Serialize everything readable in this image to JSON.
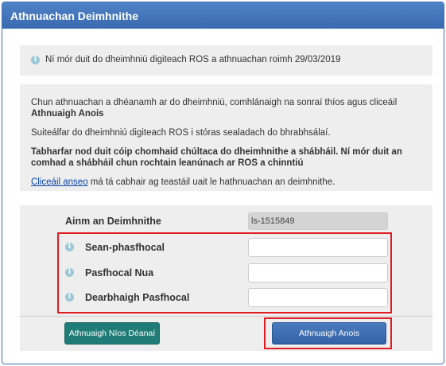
{
  "header": {
    "title": "Athnuachan Deimhnithe"
  },
  "notice": {
    "icon": "info-icon",
    "text": "Ní mór duit do dheimhniú digiteach ROS a athnuachan roimh 29/03/2019"
  },
  "info": {
    "line1_prefix": "Chun athnuachan a dhéanamh ar do dheimhniú, comhlánaigh na sonraí thíos agus cliceáil ",
    "line1_bold": "Athnuaigh Anois",
    "line2": "Suiteálfar do dheimhniú digiteach ROS i stóras sealadach do bhrabhsálaí.",
    "line3": "Tabharfar nod duit cóip chomhaid chúltaca do dheimhnithe a shábháil. Ní mór duit an comhad a shábháil chun rochtain leanúnach ar ROS a chinntiú",
    "help_link": "Cliceáil anseo",
    "help_suffix": " má tá cabhair ag teastáil uait le hathnuachan an deimhnithe."
  },
  "form": {
    "cert_label": "Ainm an Deimhnithe",
    "cert_value": "ls-1515849",
    "fields": [
      {
        "label": "Sean-phasfhocal",
        "value": ""
      },
      {
        "label": "Pasfhocal Nua",
        "value": ""
      },
      {
        "label": "Dearbhaigh Pasfhocal",
        "value": ""
      }
    ]
  },
  "buttons": {
    "later": "Athnuaigh Níos Déanaí",
    "now": "Athnuaigh Anois"
  },
  "colors": {
    "header": "#3a6ab0",
    "later_button": "#1f7c77",
    "now_button": "#3462a6",
    "highlight": "#e01b22",
    "link": "#0645ad"
  }
}
